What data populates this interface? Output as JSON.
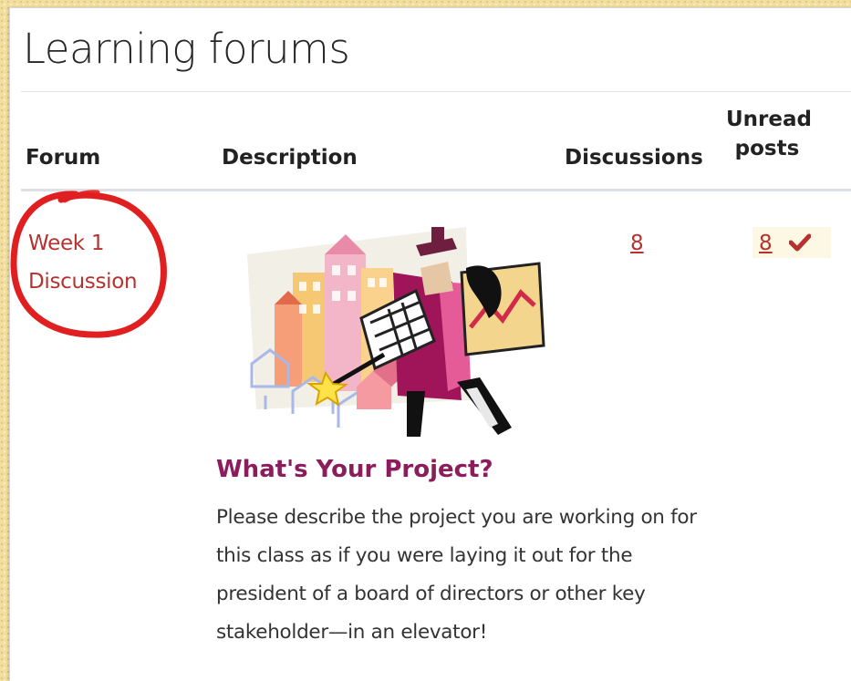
{
  "page": {
    "title": "Learning forums"
  },
  "table": {
    "headers": {
      "forum": "Forum",
      "description": "Description",
      "discussions": "Discussions",
      "unread_posts": "Unread posts"
    },
    "rows": [
      {
        "forum_name": "Week 1 Discussion",
        "description_heading": "What's Your Project?",
        "description_text": "Please describe the project you are working on for this class as if you were laying it out for the president of a board of directors or other key stakeholder—in an elevator!",
        "discussions": "8",
        "unread_posts": "8",
        "unread_icon": "check-icon"
      }
    ]
  },
  "annotation": {
    "type": "circle-highlight",
    "color": "#e02020",
    "target": "forum_name"
  },
  "colors": {
    "link": "#b5322f",
    "heading_accent": "#8c1c5b",
    "unread_highlight": "#fcf8e3",
    "page_background": "#f2dfa0"
  }
}
